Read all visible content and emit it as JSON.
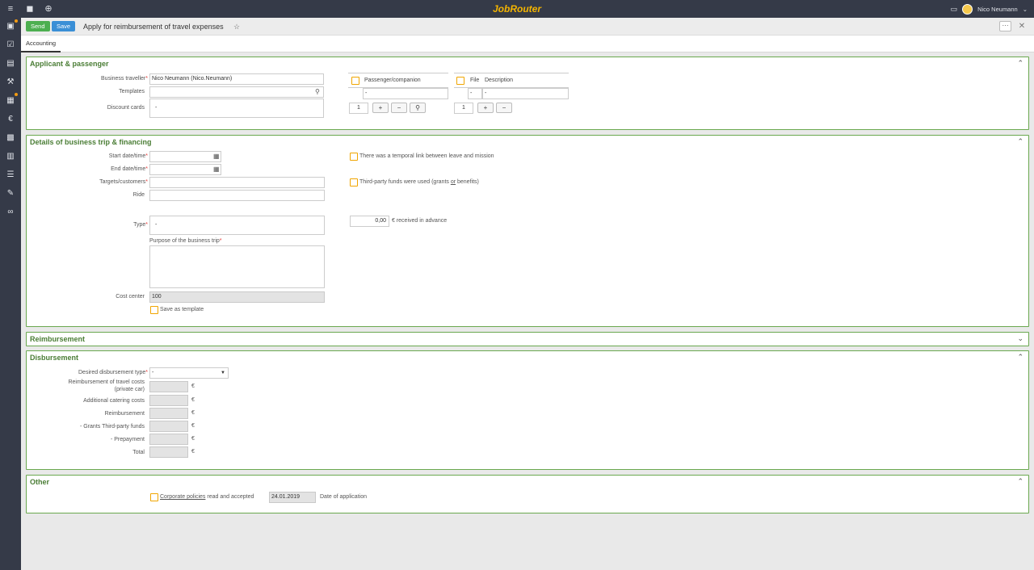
{
  "app": {
    "brand": "JobRouter",
    "user": "Nico Neumann"
  },
  "header": {
    "send": "Send",
    "save": "Save",
    "title": "Apply for reimbursement of travel expenses"
  },
  "tabs": [
    "Accounting"
  ],
  "applicant": {
    "title": "Applicant & passenger",
    "business_traveller_label": "Business traveller",
    "business_traveller_value": "Nico Neumann (Nico.Neumann)",
    "templates_label": "Templates",
    "discount_cards_label": "Discount cards",
    "discount_cards_value": "-",
    "passenger_header": "Passenger/companion",
    "passenger_cell": "-",
    "file_header": "File",
    "description_header": "Description",
    "file_cell": "-",
    "description_cell": "-",
    "row_count": "1",
    "row_count_2": "1"
  },
  "trip": {
    "title": "Details of business trip & financing",
    "start_label": "Start date/time",
    "end_label": "End date/time",
    "targets_label": "Targets/customers",
    "ride_label": "Ride",
    "type_label": "Type",
    "type_value": "-",
    "purpose_label": "Purpose of the business trip",
    "cost_center_label": "Cost center",
    "cost_center_value": "100",
    "save_template": "Save as template",
    "temporal_link": "There was a temporal link between leave and mission",
    "third_party_a": "Third-party funds were used (grants ",
    "third_party_or": "or",
    "third_party_b": " benefits)",
    "advance_value": "0,00",
    "advance_label": "€ received in advance"
  },
  "reimbursement": {
    "title": "Reimbursement"
  },
  "disbursement": {
    "title": "Disbursement",
    "type_label": "Desired disbursement type",
    "type_value": "-",
    "private_car_label_1": "Reimbursement of travel costs",
    "private_car_label_2": "(private car)",
    "catering_label": "Additional catering costs",
    "reimb_label": "Reimbursement",
    "grants_label": "- Grants Third-party funds",
    "prepayment_label": "- Prepayment",
    "total_label": "Total",
    "currency": "€"
  },
  "other": {
    "title": "Other",
    "policies_link": "Corporate policies",
    "policies_text": " read and accepted",
    "date_value": "24.01.2019",
    "date_label": "Date of application"
  }
}
